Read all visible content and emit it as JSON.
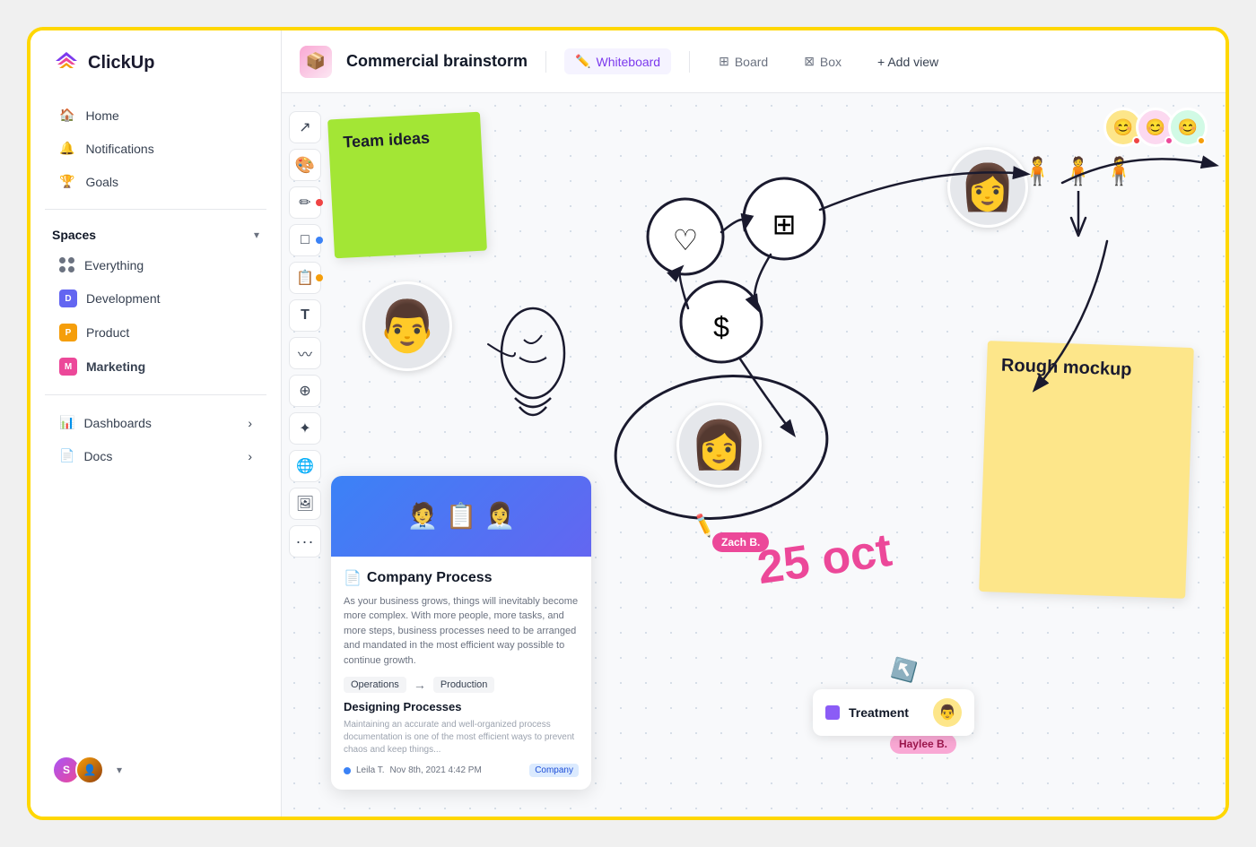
{
  "app": {
    "name": "ClickUp"
  },
  "sidebar": {
    "logo_text": "ClickUp",
    "nav": [
      {
        "id": "home",
        "label": "Home",
        "icon": "🏠"
      },
      {
        "id": "notifications",
        "label": "Notifications",
        "icon": "🔔"
      },
      {
        "id": "goals",
        "label": "Goals",
        "icon": "🏆"
      }
    ],
    "spaces_label": "Spaces",
    "spaces": [
      {
        "id": "everything",
        "label": "Everything",
        "color": ""
      },
      {
        "id": "development",
        "label": "Development",
        "color": "#6366f1",
        "letter": "D"
      },
      {
        "id": "product",
        "label": "Product",
        "color": "#f59e0b",
        "letter": "P"
      },
      {
        "id": "marketing",
        "label": "Marketing",
        "color": "#ec4899",
        "letter": "M",
        "bold": true
      }
    ],
    "dashboards_label": "Dashboards",
    "docs_label": "Docs"
  },
  "header": {
    "page_icon": "📦",
    "page_title": "Commercial brainstorm",
    "views": [
      {
        "id": "whiteboard",
        "label": "Whiteboard",
        "active": true
      },
      {
        "id": "board",
        "label": "Board",
        "active": false
      },
      {
        "id": "box",
        "label": "Box",
        "active": false
      }
    ],
    "add_view_label": "+ Add view"
  },
  "canvas": {
    "sticky_green": {
      "text": "Team ideas"
    },
    "sticky_yellow": {
      "text": "Rough mockup"
    },
    "doc_card": {
      "title": "Company Process",
      "description": "As your business grows, things will inevitably become more complex. With more people, more tasks, and more steps, business processes need to be arranged and mandated in the most efficient way possible to continue growth.",
      "tag1": "Operations",
      "tag2": "Production",
      "section_title": "Designing Processes",
      "section_desc": "Maintaining an accurate and well-organized process documentation is one of the most efficient ways to prevent chaos and keep things...",
      "author": "Leila T.",
      "date": "Nov 8th, 2021  4:42 PM",
      "company_tag": "Company"
    },
    "date_text": "25 oct",
    "cursor_labels": [
      {
        "label": "Zach B.",
        "color": "pink"
      },
      {
        "label": "Haylee B.",
        "color": "light-pink"
      }
    ],
    "treatment_card": {
      "label": "Treatment"
    }
  },
  "toolbar": {
    "tools": [
      {
        "id": "cursor",
        "icon": "↗"
      },
      {
        "id": "palette",
        "icon": "🎨"
      },
      {
        "id": "pencil",
        "icon": "✏"
      },
      {
        "id": "square",
        "icon": "□"
      },
      {
        "id": "sticky",
        "icon": "📋"
      },
      {
        "id": "text",
        "icon": "T"
      },
      {
        "id": "draw",
        "icon": "〰"
      },
      {
        "id": "connect",
        "icon": "⊕"
      },
      {
        "id": "star",
        "icon": "✦"
      },
      {
        "id": "globe",
        "icon": "🌐"
      },
      {
        "id": "image",
        "icon": "🖼"
      },
      {
        "id": "more",
        "icon": "•••"
      }
    ]
  }
}
